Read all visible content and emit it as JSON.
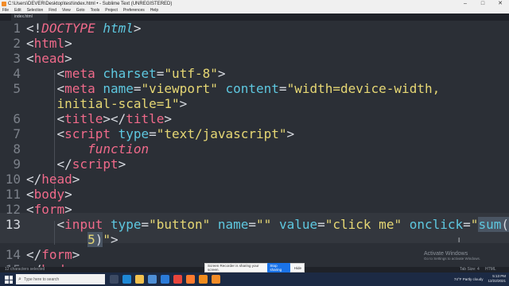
{
  "window": {
    "title": "C:\\Users\\DEVER\\Desktop\\test\\index.html • - Sublime Text (UNREGISTERED)"
  },
  "menu": [
    "File",
    "Edit",
    "Selection",
    "Find",
    "View",
    "Goto",
    "Tools",
    "Project",
    "Preferences",
    "Help"
  ],
  "tab": {
    "label": "index.html"
  },
  "line_numbers": [
    "1",
    "2",
    "3",
    "4",
    "5",
    "",
    "6",
    "7",
    "8",
    "9",
    "10",
    "11",
    "12",
    "13",
    "",
    "14",
    "15"
  ],
  "status": {
    "left": "12 characters selected",
    "tab_size": "Tab Size: 4",
    "syntax": "HTML"
  },
  "activate": {
    "title": "Activate Windows",
    "subtitle": "Go to Settings to activate Windows."
  },
  "share_bar": {
    "message": "Screen Recorder is sharing your screen.",
    "stop": "Stop sharing",
    "hide": "Hide"
  },
  "taskbar": {
    "search_placeholder": "Type here to search",
    "weather": "74°F  Partly cloudy",
    "time": "5:13 PM",
    "date": "12/22/2021"
  },
  "icons": {
    "taskbar_apps": [
      "task-view",
      "edge",
      "file-explorer",
      "store",
      "mail",
      "chrome",
      "firefox",
      "vlc",
      "sublime"
    ]
  },
  "colors": {
    "editor_bg": "#2b2f36",
    "tag": "#f06a8a",
    "attr": "#5ec8e0",
    "string": "#e6d774",
    "taskbar": "#1c2a44"
  }
}
